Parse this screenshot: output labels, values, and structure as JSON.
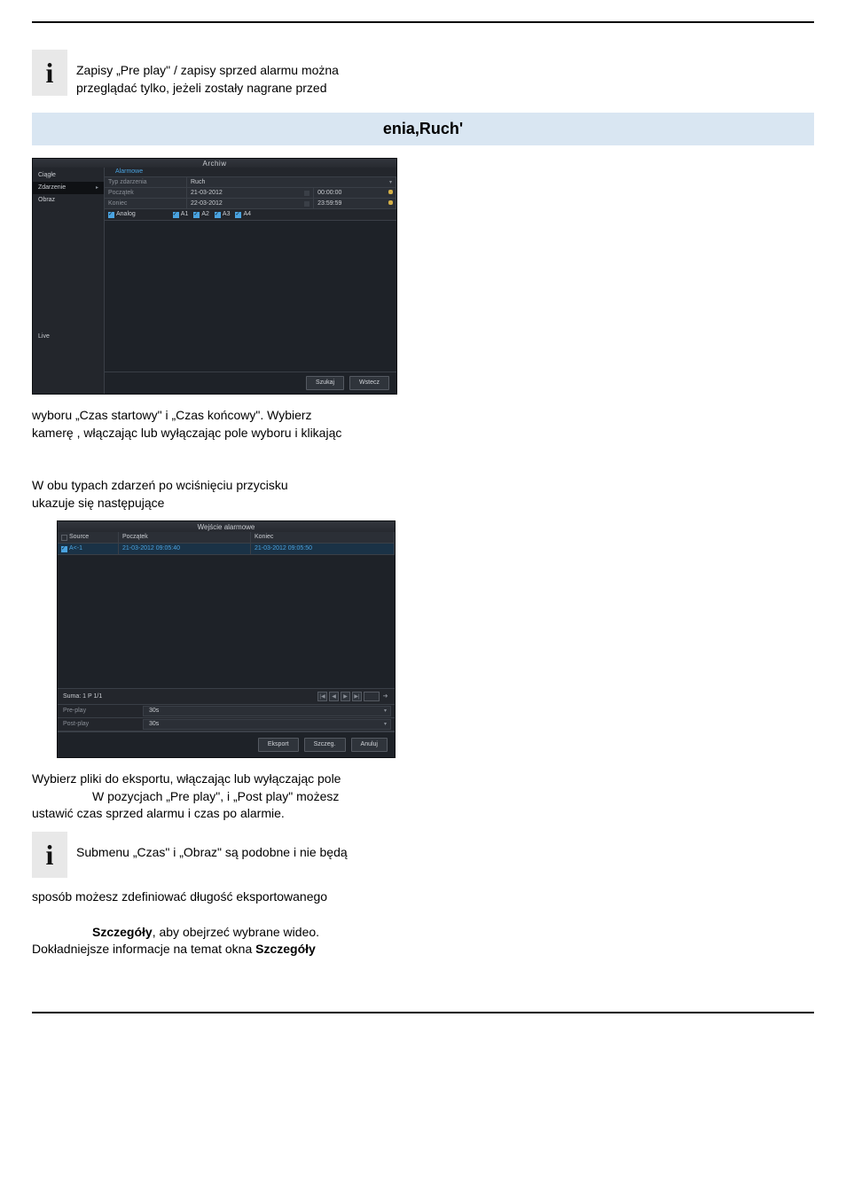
{
  "info1": {
    "glyph": "i",
    "text_line1": "Zapisy „Pre play\"  / zapisy sprzed alarmu można",
    "text_line2": "przeglądać tylko, jeżeli zostały nagrane przed"
  },
  "band": {
    "text": "enia,Ruch'"
  },
  "scr1": {
    "title": "Archiw",
    "side": {
      "items": [
        "Ciągłe",
        "Zdarzenie",
        "Obraz"
      ],
      "active_index": 1,
      "live": "Live"
    },
    "tabs": {
      "items": [
        "Alarmowe"
      ],
      "active_index": 0
    },
    "form": {
      "rows": [
        {
          "label": "Typ zdarzenia",
          "value": "Ruch",
          "kind": "select"
        },
        {
          "label": "Początek",
          "date": "21-03-2012",
          "time": "00:00:00"
        },
        {
          "label": "Koniec",
          "date": "22-03-2012",
          "time": "23:59:59"
        }
      ],
      "analog": {
        "label": "Analog",
        "items": [
          "A1",
          "A2",
          "A3",
          "A4"
        ]
      }
    },
    "buttons": {
      "search": "Szukaj",
      "back": "Wstecz"
    }
  },
  "para1": {
    "l1": "wyboru „Czas startowy\" i „Czas końcowy\". Wybierz",
    "l2": "kamerę , włączając lub wyłączając pole wyboru i klikając"
  },
  "para2": {
    "l1": "W obu typach zdarzeń po wciśnięciu przycisku",
    "l2": "ukazuje się następujące"
  },
  "scr2": {
    "title": "Wejście alarmowe",
    "columns": {
      "sel": "Source",
      "start": "Początek",
      "end": "Koniec"
    },
    "row": {
      "source": "A<-1",
      "start": "21-03-2012 09:05:40",
      "end": "21-03-2012 09:05:50"
    },
    "status_total": "Suma: 1 P 1/1",
    "pager": {
      "first": "|◀",
      "prev": "◀",
      "next": "▶",
      "last": "▶|",
      "go": "➜"
    },
    "pre": {
      "label": "Pre-play",
      "value": "30s"
    },
    "post": {
      "label": "Post-play",
      "value": "30s"
    },
    "buttons": {
      "export": "Eksport",
      "details": "Szczeg.",
      "cancel": "Anuluj"
    }
  },
  "para3": {
    "l1": "Wybierz pliki do eksportu, włączając lub wyłączając pole",
    "l2": "W pozycjach „Pre play\", i „Post play\" możesz",
    "l3": "ustawić czas sprzed alarmu i czas po alarmie."
  },
  "info2": {
    "glyph": "i",
    "text": "Submenu „Czas\" i „Obraz\" są podobne i nie będą"
  },
  "para4": {
    "l1": "sposób możesz zdefiniować długość eksportowanego"
  },
  "para5": {
    "l1_a": "Szczegóły",
    "l1_b": ", aby obejrzeć wybrane wideo.",
    "l2_a": "Dokładniejsze informacje na temat okna ",
    "l2_b": "Szczegóły"
  }
}
